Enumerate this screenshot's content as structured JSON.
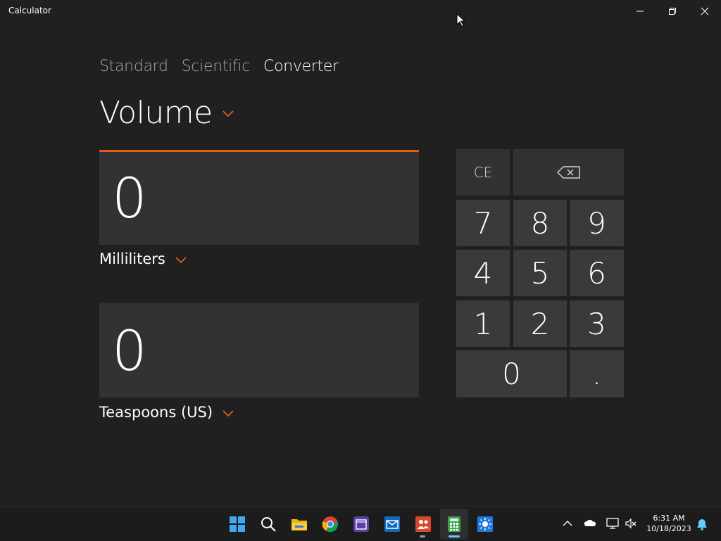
{
  "window": {
    "title": "Calculator"
  },
  "modes": [
    {
      "label": "Standard"
    },
    {
      "label": "Scientific"
    },
    {
      "label": "Converter"
    }
  ],
  "category": "Volume",
  "from": {
    "value": "0",
    "unit": "Milliliters"
  },
  "to": {
    "value": "0",
    "unit": "Teaspoons (US)"
  },
  "keypad": {
    "ce": "CE",
    "backspace_icon": "backspace-icon",
    "digits": [
      "7",
      "8",
      "9",
      "4",
      "5",
      "6",
      "1",
      "2",
      "3"
    ],
    "zero": "0",
    "decimal": "."
  },
  "taskbar": {
    "icons": [
      "start-icon",
      "search-icon",
      "file-explorer-icon",
      "chrome-icon",
      "calendar-app-icon",
      "mail-icon",
      "teams-icon",
      "calculator-icon",
      "weather-icon"
    ],
    "time": "6:31 AM",
    "date": "10/18/2023"
  },
  "colors": {
    "accent": "#e05d1b",
    "background": "#202020",
    "key": "#3a3a3a"
  }
}
